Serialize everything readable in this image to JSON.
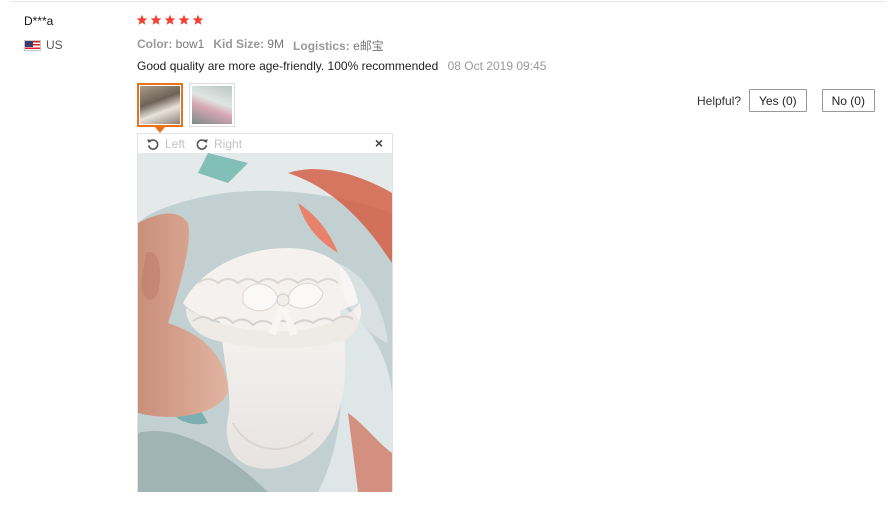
{
  "review": {
    "buyer_name": "D***a",
    "country": "US",
    "rating": 5,
    "attributes": [
      {
        "key": "Color:",
        "value": "bow1"
      },
      {
        "key": "Kid Size:",
        "value": "9M"
      },
      {
        "key": "Logistics:",
        "value": "e邮宝"
      }
    ],
    "text": "Good quality are more age-friendly. 100% recommended",
    "date": "08 Oct 2019 09:45",
    "photos_count": 2,
    "selected_photo": 1
  },
  "helpful": {
    "label": "Helpful?",
    "yes_label": "Yes (0)",
    "no_label": "No (0)"
  },
  "viewer": {
    "rotate_left_label": "Left",
    "rotate_right_label": "Right",
    "close_symbol": "×"
  },
  "colors": {
    "star": "#f44336",
    "active_thumb_border": "#e8731a"
  },
  "icons": [
    "us-flag-icon",
    "star-icon",
    "rotate-left-icon",
    "rotate-right-icon",
    "close-icon"
  ]
}
